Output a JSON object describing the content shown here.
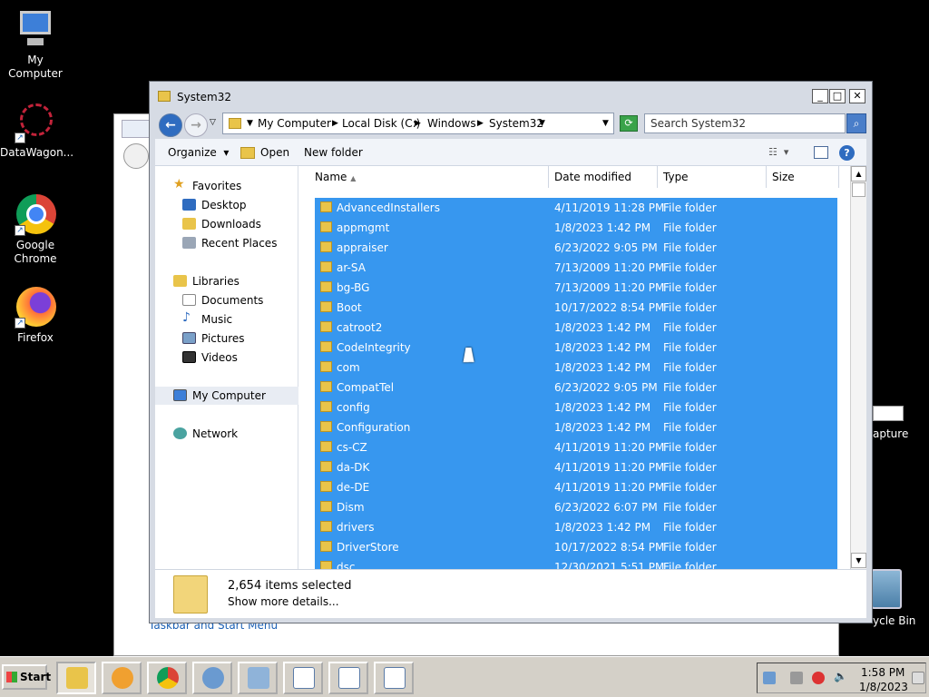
{
  "desktop": {
    "icons": [
      {
        "label": "My Computer"
      },
      {
        "label": "DataWagon..."
      },
      {
        "label": "Google Chrome"
      },
      {
        "label": "Firefox"
      }
    ],
    "right_labels": {
      "capture": "apture",
      "recycle": "ycle Bin"
    }
  },
  "background_window": {
    "link_text": "Taskbar and Start Menu"
  },
  "window": {
    "title": "System32",
    "controls": {
      "minimize": "_",
      "maximize": "□",
      "close": "✕"
    },
    "address": {
      "crumbs": [
        "My Computer",
        "Local Disk (C:)",
        "Windows",
        "System32"
      ]
    },
    "search": {
      "placeholder": "Search System32"
    },
    "toolbar": {
      "organize": "Organize",
      "open": "Open",
      "new_folder": "New folder"
    },
    "nav": {
      "favorites": "Favorites",
      "desktop": "Desktop",
      "downloads": "Downloads",
      "recent": "Recent Places",
      "libraries": "Libraries",
      "documents": "Documents",
      "music": "Music",
      "pictures": "Pictures",
      "videos": "Videos",
      "my_computer": "My Computer",
      "network": "Network"
    },
    "columns": {
      "name": "Name",
      "date": "Date modified",
      "type": "Type",
      "size": "Size"
    },
    "rows": [
      {
        "name": "AdvancedInstallers",
        "date": "4/11/2019 11:28 PM",
        "type": "File folder"
      },
      {
        "name": "appmgmt",
        "date": "1/8/2023 1:42 PM",
        "type": "File folder"
      },
      {
        "name": "appraiser",
        "date": "6/23/2022 9:05 PM",
        "type": "File folder"
      },
      {
        "name": "ar-SA",
        "date": "7/13/2009 11:20 PM",
        "type": "File folder"
      },
      {
        "name": "bg-BG",
        "date": "7/13/2009 11:20 PM",
        "type": "File folder"
      },
      {
        "name": "Boot",
        "date": "10/17/2022 8:54 PM",
        "type": "File folder"
      },
      {
        "name": "catroot2",
        "date": "1/8/2023 1:42 PM",
        "type": "File folder"
      },
      {
        "name": "CodeIntegrity",
        "date": "1/8/2023 1:42 PM",
        "type": "File folder"
      },
      {
        "name": "com",
        "date": "1/8/2023 1:42 PM",
        "type": "File folder"
      },
      {
        "name": "CompatTel",
        "date": "6/23/2022 9:05 PM",
        "type": "File folder"
      },
      {
        "name": "config",
        "date": "1/8/2023 1:42 PM",
        "type": "File folder"
      },
      {
        "name": "Configuration",
        "date": "1/8/2023 1:42 PM",
        "type": "File folder"
      },
      {
        "name": "cs-CZ",
        "date": "4/11/2019 11:20 PM",
        "type": "File folder"
      },
      {
        "name": "da-DK",
        "date": "4/11/2019 11:20 PM",
        "type": "File folder"
      },
      {
        "name": "de-DE",
        "date": "4/11/2019 11:20 PM",
        "type": "File folder"
      },
      {
        "name": "Dism",
        "date": "6/23/2022 6:07 PM",
        "type": "File folder"
      },
      {
        "name": "drivers",
        "date": "1/8/2023 1:42 PM",
        "type": "File folder"
      },
      {
        "name": "DriverStore",
        "date": "10/17/2022 8:54 PM",
        "type": "File folder"
      },
      {
        "name": "dsc",
        "date": "12/30/2021 5:51 PM",
        "type": "File folder"
      }
    ],
    "details": {
      "count": "2,654 items selected",
      "more": "Show more details..."
    }
  },
  "taskbar": {
    "start": "Start",
    "clock": {
      "time": "1:58 PM",
      "date": "1/8/2023"
    }
  },
  "colors": {
    "selection": "#3797ef",
    "folder": "#e9c44a",
    "link": "#1a5fb4"
  }
}
